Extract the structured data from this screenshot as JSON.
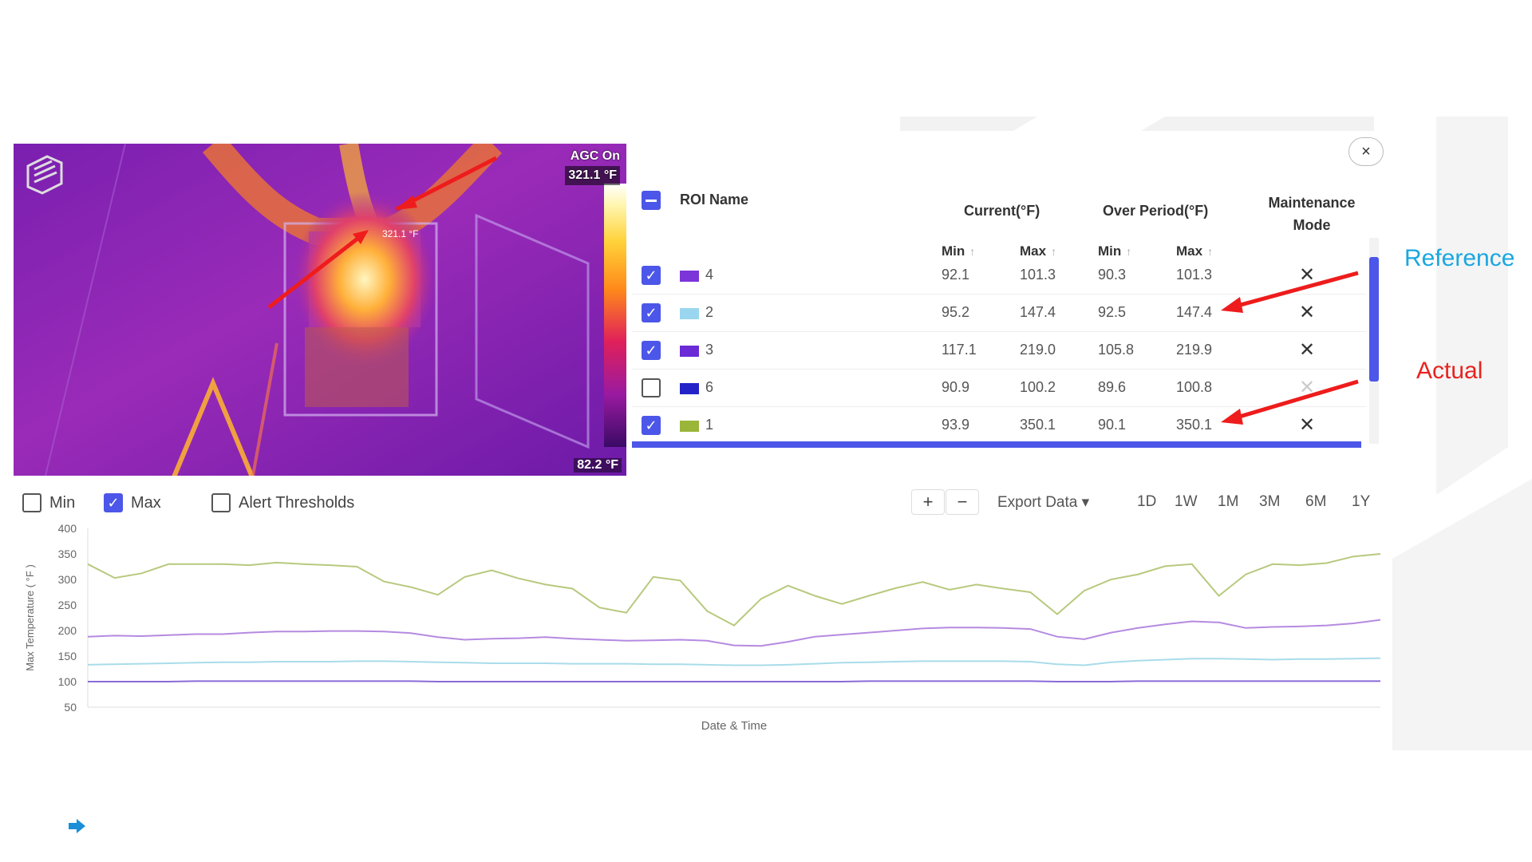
{
  "thermal": {
    "agc_label": "AGC On",
    "max_temp": "321.1 °F",
    "min_temp": "82.2 °F",
    "roi_label": "321.1 °F",
    "logo_icon": "cube-logo-icon"
  },
  "close_icon": "×",
  "table": {
    "header": {
      "roi_name": "ROI Name",
      "current": "Current(°F)",
      "over_period": "Over Period(°F)",
      "maintenance_line1": "Maintenance",
      "maintenance_line2": "Mode",
      "min": "Min",
      "max": "Max",
      "sort_arrow": "↑"
    },
    "rows": [
      {
        "checked": "✓",
        "color": "#7b35d9",
        "name": "4",
        "cur_min": "92.1",
        "cur_max": "101.3",
        "per_min": "90.3",
        "per_max": "101.3"
      },
      {
        "checked": "✓",
        "color": "#9ad6ef",
        "name": "2",
        "cur_min": "95.2",
        "cur_max": "147.4",
        "per_min": "92.5",
        "per_max": "147.4"
      },
      {
        "checked": "✓",
        "color": "#6a2ad6",
        "name": "3",
        "cur_min": "117.1",
        "cur_max": "219.0",
        "per_min": "105.8",
        "per_max": "219.9"
      },
      {
        "checked": "",
        "color": "#2323c8",
        "name": "6",
        "cur_min": "90.9",
        "cur_max": "100.2",
        "per_min": "89.6",
        "per_max": "100.8"
      },
      {
        "checked": "✓",
        "color": "#9ab53a",
        "name": "1",
        "cur_min": "93.9",
        "cur_max": "350.1",
        "per_min": "90.1",
        "per_max": "350.1"
      }
    ],
    "tool_icon": "✕"
  },
  "annotations": {
    "reference": "Reference",
    "reference_color": "#1aa7e0",
    "actual": "Actual",
    "actual_color": "#e8231f"
  },
  "controls": {
    "min_label": "Min",
    "max_label": "Max",
    "max_check": "✓",
    "alert_label": "Alert Thresholds",
    "zoom_in": "+",
    "zoom_out": "−",
    "export": "Export Data ▾",
    "ranges": [
      "1D",
      "1W",
      "1M",
      "3M",
      "6M",
      "1Y"
    ]
  },
  "accent_color": "#4c56e8",
  "chart_data": {
    "type": "line",
    "xlabel": "Date & Time",
    "ylabel": "Max Temperature ( °F )",
    "ylim": [
      50,
      400
    ],
    "yticks": [
      400,
      350,
      300,
      250,
      200,
      150,
      100,
      50
    ],
    "grid": false,
    "series": [
      {
        "color": "#b7c97e",
        "values": [
          330,
          303,
          312,
          330,
          330,
          330,
          328,
          333,
          330,
          328,
          325,
          296,
          285,
          270,
          305,
          318,
          302,
          290,
          282,
          245,
          235,
          305,
          298,
          238,
          210,
          262,
          288,
          268,
          252,
          268,
          283,
          295,
          280,
          290,
          282,
          275,
          232,
          278,
          300,
          310,
          326,
          330,
          268,
          310,
          330,
          328,
          332,
          345,
          350
        ]
      },
      {
        "color": "#b58ae0",
        "values": [
          188,
          190,
          189,
          191,
          193,
          193,
          196,
          198,
          198,
          199,
          199,
          198,
          195,
          187,
          182,
          184,
          185,
          187,
          184,
          182,
          180,
          181,
          182,
          180,
          171,
          170,
          178,
          188,
          192,
          196,
          200,
          204,
          206,
          206,
          205,
          203,
          188,
          183,
          196,
          205,
          212,
          218,
          216,
          205,
          207,
          208,
          210,
          214,
          221
        ]
      },
      {
        "color": "#a9dcea",
        "values": [
          133,
          134,
          135,
          136,
          137,
          138,
          138,
          139,
          139,
          139,
          140,
          140,
          139,
          138,
          137,
          136,
          136,
          136,
          135,
          135,
          135,
          134,
          134,
          133,
          132,
          132,
          133,
          135,
          137,
          138,
          139,
          140,
          140,
          140,
          140,
          139,
          134,
          132,
          138,
          141,
          143,
          145,
          145,
          144,
          143,
          144,
          144,
          145,
          146
        ]
      },
      {
        "color": "#8b6ad8",
        "values": [
          100,
          100,
          100,
          100,
          101,
          101,
          101,
          101,
          101,
          101,
          101,
          101,
          101,
          100,
          100,
          100,
          100,
          100,
          100,
          100,
          100,
          100,
          100,
          100,
          100,
          100,
          100,
          100,
          100,
          101,
          101,
          101,
          101,
          101,
          101,
          101,
          100,
          100,
          100,
          101,
          101,
          101,
          101,
          101,
          101,
          101,
          101,
          101,
          101
        ]
      }
    ]
  },
  "footer_icon": "➡"
}
